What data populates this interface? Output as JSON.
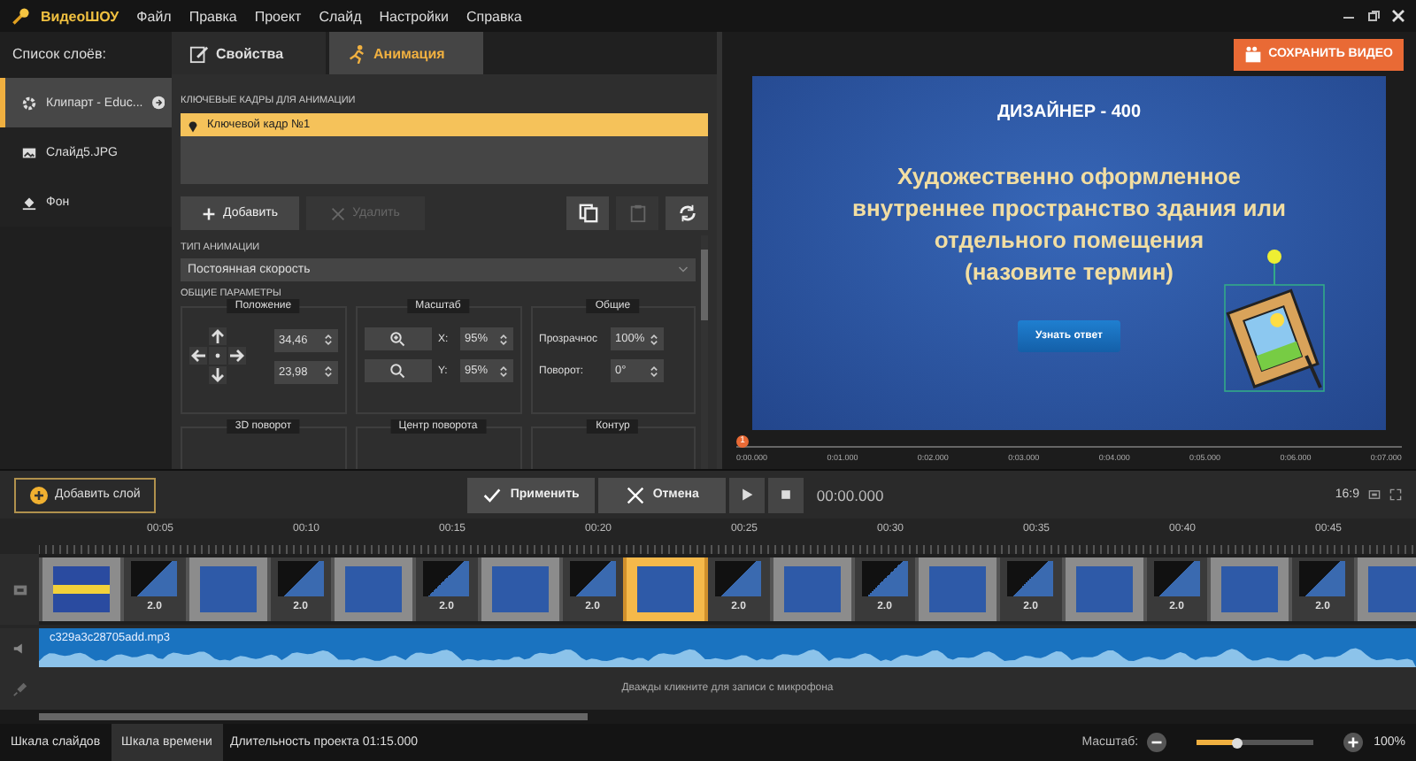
{
  "app": {
    "title": "ВидеоШОУ",
    "menu": [
      "Файл",
      "Правка",
      "Проект",
      "Слайд",
      "Настройки",
      "Справка"
    ]
  },
  "layers": {
    "title": "Список слоёв:",
    "items": [
      {
        "label": "Клипарт - Educ...",
        "kind": "clipart",
        "selected": true
      },
      {
        "label": "Слайд5.JPG",
        "kind": "image",
        "selected": false
      },
      {
        "label": "Фон",
        "kind": "fill",
        "selected": false
      }
    ]
  },
  "tabs": [
    {
      "label": "Свойства",
      "kind": "properties",
      "selected": false
    },
    {
      "label": "Анимация",
      "kind": "animation",
      "selected": true
    }
  ],
  "keyframes": {
    "title": "КЛЮЧЕВЫЕ КАДРЫ ДЛЯ АНИМАЦИИ",
    "items": [
      {
        "label": "Ключевой кадр №1",
        "selected": true
      }
    ],
    "buttons": [
      {
        "label": "Добавить",
        "kind": "add",
        "disabled": false
      },
      {
        "label": "Удалить",
        "kind": "delete",
        "disabled": true
      }
    ],
    "tools": [
      {
        "kind": "copy",
        "disabled": false
      },
      {
        "kind": "paste",
        "disabled": true
      },
      {
        "kind": "reset",
        "disabled": false
      }
    ]
  },
  "animation_type": {
    "label": "ТИП АНИМАЦИИ",
    "value": "Постоянная скорость"
  },
  "params": {
    "title": "ОБЩИЕ ПАРАМЕТРЫ",
    "groups": [
      {
        "title": "Положение",
        "kind": "position",
        "fields": [
          {
            "value": "34,46"
          },
          {
            "value": "23,98"
          }
        ]
      },
      {
        "title": "Масштаб",
        "kind": "scale",
        "fields": [
          {
            "label": "X:",
            "value": "95%"
          },
          {
            "label": "Y:",
            "value": "95%"
          }
        ]
      },
      {
        "title": "Общие",
        "kind": "general",
        "fields": [
          {
            "label": "Прозрачнос",
            "value": "100%"
          },
          {
            "label": "Поворот:",
            "value": "0°"
          }
        ]
      },
      {
        "title": "3D поворот",
        "kind": "general"
      },
      {
        "title": "Центр поворота",
        "kind": "general"
      },
      {
        "title": "Контур",
        "kind": "general"
      }
    ]
  },
  "preview": {
    "save_button": "СОХРАНИТЬ ВИДЕО",
    "slide": {
      "heading": "ДИЗАЙНЕР - 400",
      "question_lines": [
        "Художественно оформленное",
        "внутреннее пространство здания или",
        "отдельного помещения",
        "(назовите термин)"
      ],
      "button": "Узнать ответ"
    },
    "marker": "1",
    "ruler": [
      "0:00.000",
      "0:01.000",
      "0:02.000",
      "0:03.000",
      "0:04.000",
      "0:05.000",
      "0:06.000",
      "0:07.000"
    ]
  },
  "toolbar": {
    "add_layer": "Добавить слой",
    "apply": "Применить",
    "cancel": "Отмена",
    "time": "00:00.000",
    "aspect": "16:9"
  },
  "timeline": {
    "ticks": [
      "00:05",
      "00:10",
      "00:15",
      "00:20",
      "00:25",
      "00:30",
      "00:35",
      "00:40",
      "00:45"
    ],
    "slides": [
      {
        "selected": false,
        "transition": "2.0"
      },
      {
        "selected": false,
        "transition": "2.0"
      },
      {
        "selected": false,
        "transition": "2.0"
      },
      {
        "selected": false,
        "transition": "2.0"
      },
      {
        "selected": true,
        "transition": "2.0"
      },
      {
        "selected": false,
        "transition": "2.0"
      },
      {
        "selected": false,
        "transition": "2.0"
      },
      {
        "selected": false,
        "transition": "2.0"
      },
      {
        "selected": false,
        "transition": "2.0"
      },
      {
        "selected": false
      }
    ],
    "audio": "c329a3c28705add.mp3",
    "mic_hint": "Дважды кликните для записи с микрофона"
  },
  "status": {
    "tabs": [
      {
        "label": "Шкала слайдов",
        "selected": false
      },
      {
        "label": "Шкала времени",
        "selected": true
      }
    ],
    "duration": "Длительность проекта 01:15.000",
    "zoom_label": "Масштаб:",
    "zoom": {
      "level": 0.35
    },
    "zoom_value": "100%"
  }
}
